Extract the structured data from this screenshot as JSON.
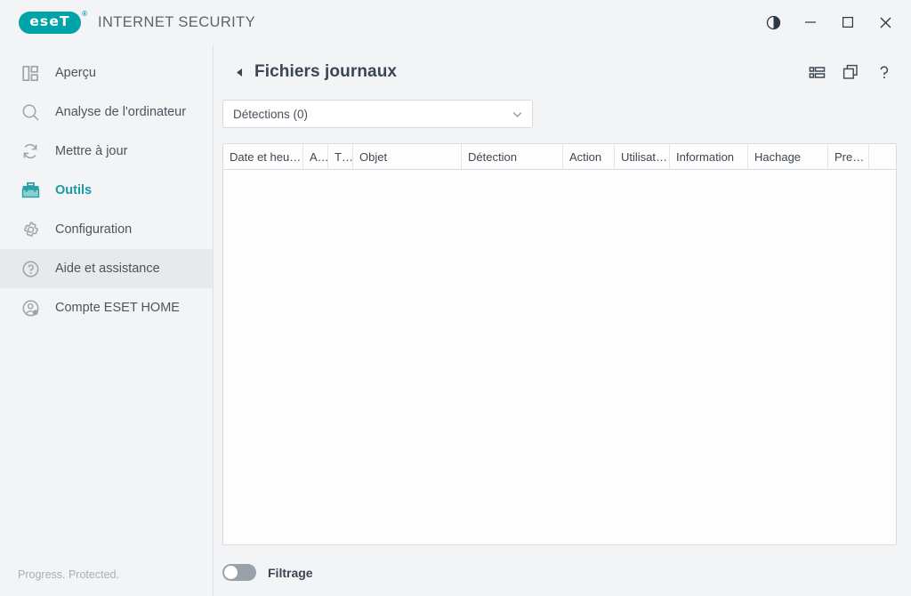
{
  "titlebar": {
    "logo_text": "eseT",
    "logo_reg": "®",
    "product_name": "INTERNET SECURITY",
    "brand_color": "#00a3a8",
    "controls": [
      {
        "name": "theme-toggle",
        "label": "Theme"
      },
      {
        "name": "minimize",
        "label": "Minimize"
      },
      {
        "name": "maximize",
        "label": "Maximize"
      },
      {
        "name": "close",
        "label": "Close"
      }
    ]
  },
  "sidebar": {
    "items": [
      {
        "label": "Aperçu",
        "icon": "dashboard-icon",
        "state": "normal"
      },
      {
        "label": "Analyse de l'ordinateur",
        "icon": "magnifier-icon",
        "state": "normal"
      },
      {
        "label": "Mettre à jour",
        "icon": "refresh-icon",
        "state": "normal"
      },
      {
        "label": "Outils",
        "icon": "toolbox-icon",
        "state": "active"
      },
      {
        "label": "Configuration",
        "icon": "gear-icon",
        "state": "normal"
      },
      {
        "label": "Aide et assistance",
        "icon": "question-circle-icon",
        "state": "hover"
      },
      {
        "label": "Compte ESET HOME",
        "icon": "user-circle-icon",
        "state": "normal"
      }
    ],
    "status": "Progress. Protected.",
    "active_color": "#1a9ba1"
  },
  "main": {
    "back_label": "Retour",
    "title": "Fichiers journaux",
    "header_actions": [
      {
        "name": "list-view-icon",
        "label": "Affichage"
      },
      {
        "name": "copy-window-icon",
        "label": "Nouvelle fenêtre"
      },
      {
        "name": "help-icon",
        "label": "Aide"
      }
    ],
    "log_filter": {
      "selected": "Détections (0)",
      "placeholder": "Détections (0)"
    },
    "table": {
      "columns": [
        {
          "label": "Date et heu…",
          "width": 90
        },
        {
          "label": "A…",
          "width": 28
        },
        {
          "label": "T…",
          "width": 28
        },
        {
          "label": "Objet",
          "width": 122
        },
        {
          "label": "Détection",
          "width": 114
        },
        {
          "label": "Action",
          "width": 58
        },
        {
          "label": "Utilisat…",
          "width": 62
        },
        {
          "label": "Information",
          "width": 88
        },
        {
          "label": "Hachage",
          "width": 90
        },
        {
          "label": "Pre…",
          "width": 46
        },
        {
          "label": "",
          "width": 30
        }
      ],
      "rows": []
    },
    "filter_toggle": {
      "label": "Filtrage",
      "enabled": false
    }
  }
}
